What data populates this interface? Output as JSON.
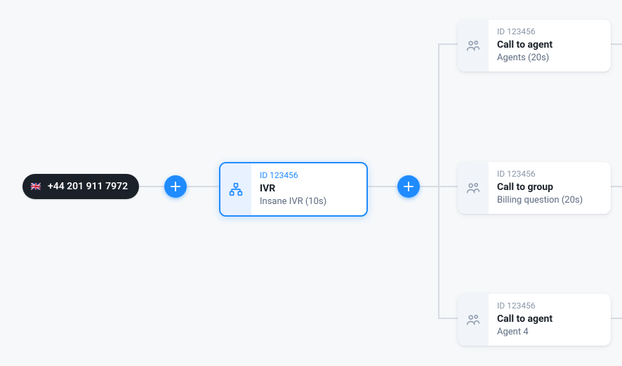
{
  "phone": {
    "flag": "🇬🇧",
    "number": "+44 201 911 7972"
  },
  "nodes": {
    "ivr": {
      "id": "ID 123456",
      "title": "IVR",
      "subtitle": "Insane IVR (10s)"
    },
    "branch1": {
      "id": "ID 123456",
      "title": "Call to agent",
      "subtitle": "Agents (20s)"
    },
    "branch2": {
      "id": "ID 123456",
      "title": "Call to group",
      "subtitle": "Billing question (20s)"
    },
    "branch3": {
      "id": "ID 123456",
      "title": "Call to agent",
      "subtitle": "Agent 4"
    }
  }
}
